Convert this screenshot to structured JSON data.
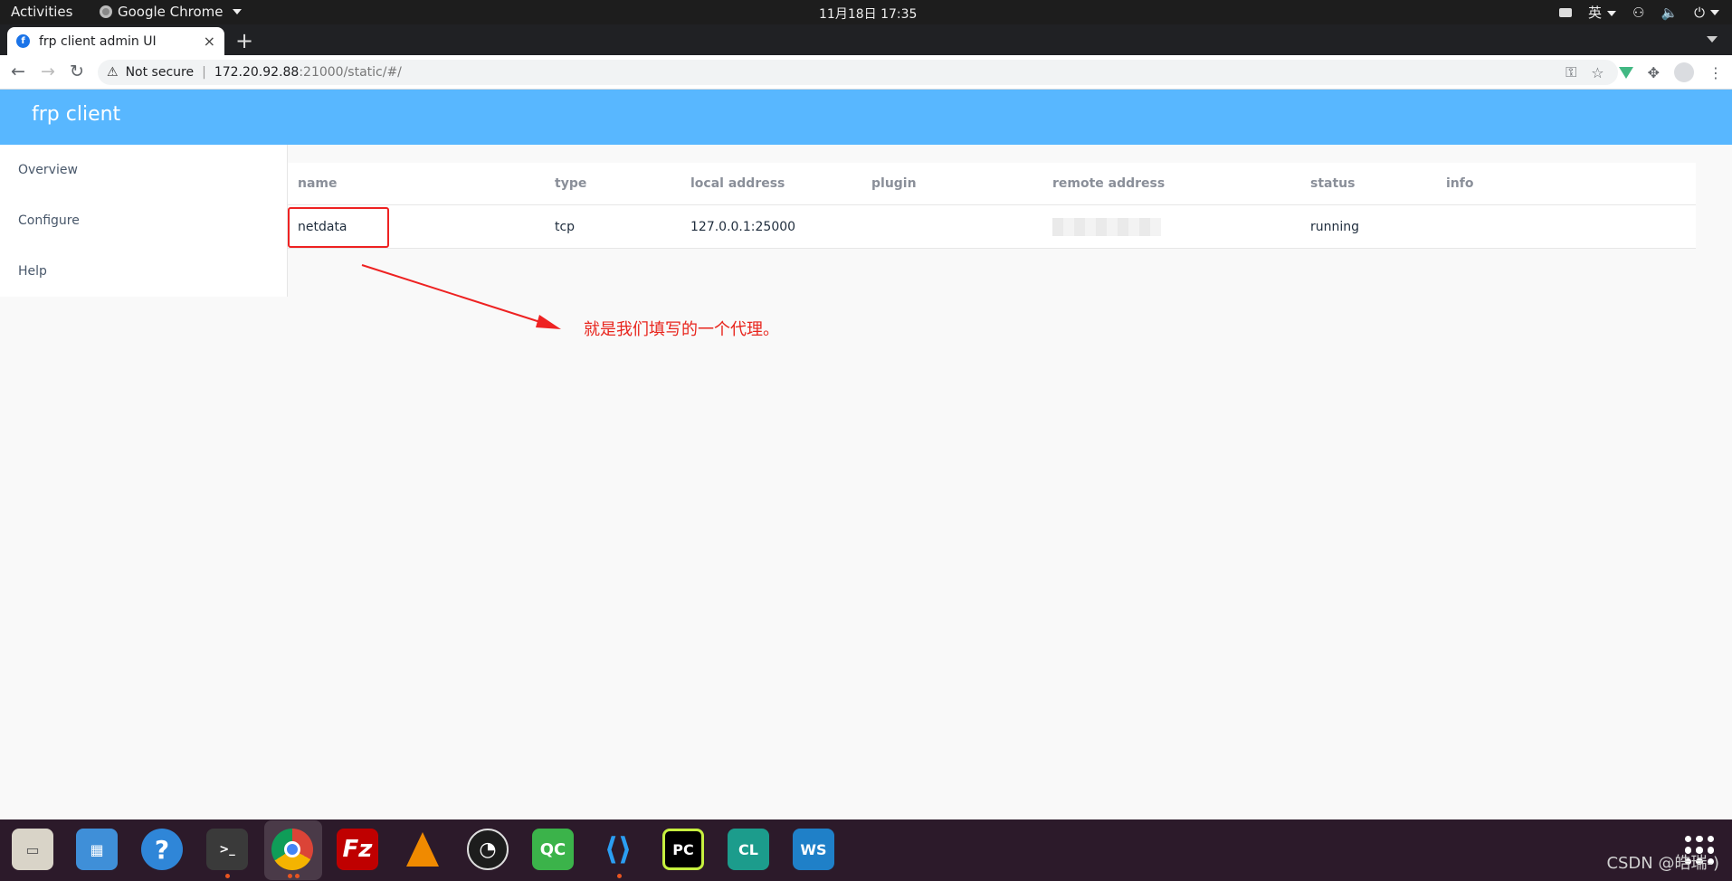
{
  "gnome_topbar": {
    "activities": "Activities",
    "app_name": "Google Chrome",
    "clock": "11月18日  17:35",
    "input_method": "英"
  },
  "browser": {
    "tab_title": "frp client admin UI",
    "tab_close": "×",
    "new_tab": "+",
    "security_label": "Not secure",
    "url_host": "172.20.92.88",
    "url_path": ":21000/static/#/"
  },
  "app": {
    "brand": "frp client",
    "sidebar": {
      "items": [
        {
          "label": "Overview"
        },
        {
          "label": "Configure"
        },
        {
          "label": "Help"
        }
      ]
    },
    "table": {
      "columns": {
        "name": "name",
        "type": "type",
        "local_address": "local address",
        "plugin": "plugin",
        "remote_address": "remote address",
        "status": "status",
        "info": "info"
      },
      "rows": [
        {
          "name": "netdata",
          "type": "tcp",
          "local_address": "127.0.0.1:25000",
          "plugin": "",
          "remote_address": "",
          "status": "running",
          "info": ""
        }
      ]
    }
  },
  "annotation": {
    "text": "就是我们填写的一个代理。",
    "color": "#e8251d"
  },
  "dock": {
    "icons": [
      "files-icon",
      "software-store-icon",
      "help-icon",
      "terminal-icon",
      "chrome-icon",
      "filezilla-icon",
      "vlc-icon",
      "obs-icon",
      "qtcreator-icon",
      "vscode-icon",
      "pycharm-icon",
      "clion-icon",
      "webstorm-icon"
    ],
    "watermark": "CSDN @皓瑞-)"
  },
  "colors": {
    "header_blue": "#58b7ff",
    "annotation_red": "#ee2222"
  }
}
